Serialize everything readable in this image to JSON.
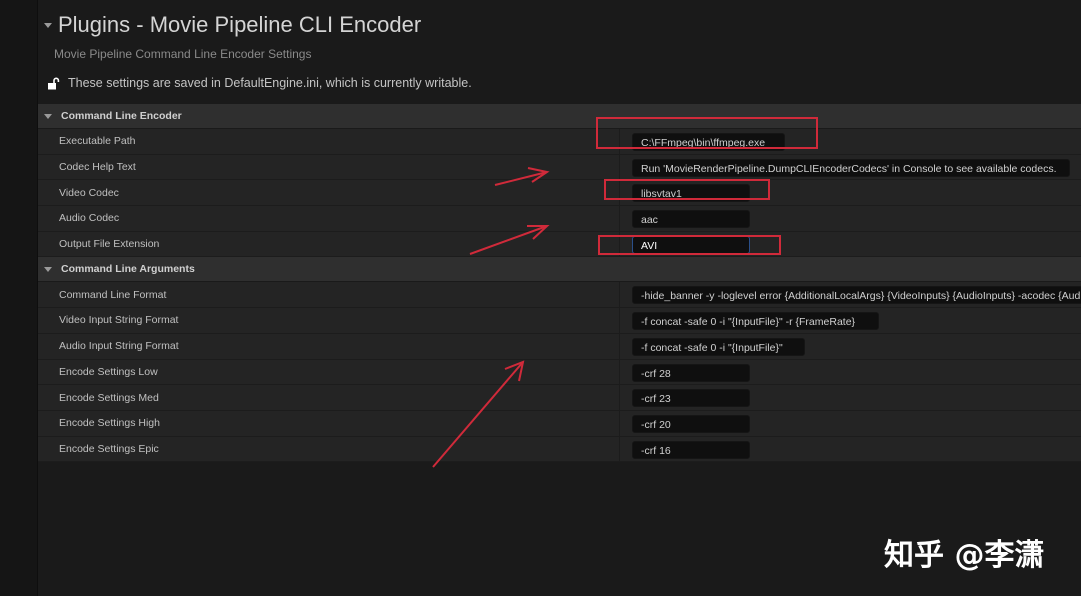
{
  "header": {
    "title": "Plugins - Movie Pipeline CLI Encoder",
    "subtitle": "Movie Pipeline Command Line Encoder Settings",
    "notice": "These settings are saved in DefaultEngine.ini, which is currently writable."
  },
  "sections": [
    {
      "label": "Command Line Encoder",
      "rows": [
        {
          "label": "Executable Path",
          "value": "C:\\FFmpeg\\bin\\ffmpeg.exe"
        },
        {
          "label": "Codec Help Text",
          "value": "Run 'MovieRenderPipeline.DumpCLIEncoderCodecs' in Console to see available codecs."
        },
        {
          "label": "Video Codec",
          "value": "libsvtav1"
        },
        {
          "label": "Audio Codec",
          "value": "aac"
        },
        {
          "label": "Output File Extension",
          "value": "AVI"
        }
      ]
    },
    {
      "label": "Command Line Arguments",
      "rows": [
        {
          "label": "Command Line Format",
          "value": "-hide_banner -y -loglevel error {AdditionalLocalArgs} {VideoInputs} {AudioInputs} -acodec {AudioCodec}"
        },
        {
          "label": "Video Input String Format",
          "value": "-f concat -safe 0 -i \"{InputFile}\" -r {FrameRate}"
        },
        {
          "label": "Audio Input String Format",
          "value": "-f concat -safe 0 -i \"{InputFile}\""
        },
        {
          "label": "Encode Settings Low",
          "value": "-crf 28"
        },
        {
          "label": "Encode Settings Med",
          "value": "-crf 23"
        },
        {
          "label": "Encode Settings High",
          "value": "-crf 20"
        },
        {
          "label": "Encode Settings Epic",
          "value": "-crf 16"
        }
      ]
    }
  ],
  "watermark": "知乎 @李潇",
  "colors": {
    "annotation": "#d02a3a",
    "focus": "#2a4f8a"
  },
  "icons": {
    "notice": "unlock-icon",
    "collapse": "triangle-down-icon"
  }
}
